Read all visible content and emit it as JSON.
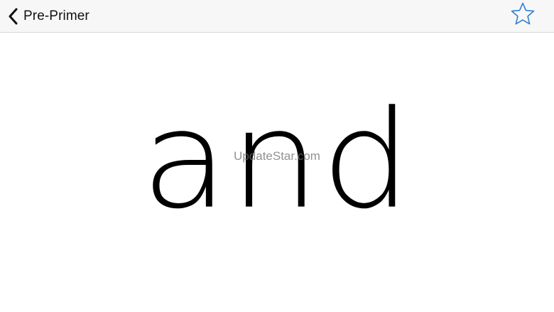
{
  "nav": {
    "back_label": "Pre-Primer",
    "back_icon": "chevron-left-icon",
    "favorite_icon": "star-outline-icon",
    "accent_color": "#2f7fd6"
  },
  "card": {
    "word": "and"
  },
  "watermark": {
    "text": "UpdateStar.com"
  }
}
